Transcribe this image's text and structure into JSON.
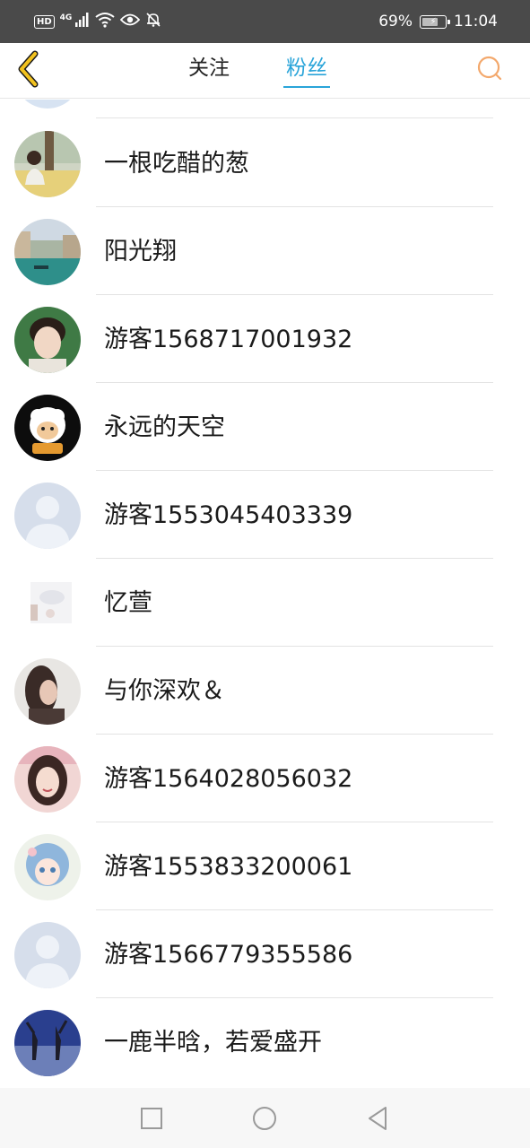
{
  "status_bar": {
    "left_badge": "HD",
    "network": "4G",
    "battery_text": "69%",
    "battery_level": 0.69,
    "time": "11:04",
    "icons": [
      "hd-icon",
      "signal-icon",
      "wifi-icon",
      "eye-icon",
      "bell-off-icon",
      "battery-icon"
    ]
  },
  "header": {
    "back_icon": "chevron-left-icon",
    "tabs": [
      {
        "label": "关注",
        "active": false
      },
      {
        "label": "粉丝",
        "active": true
      }
    ],
    "search_icon": "search-icon",
    "colors": {
      "active_tab": "#29a4d9",
      "back_icon": "#f2c21f",
      "search_icon": "#f3a86c"
    }
  },
  "fans": [
    {
      "name": "一根吃醋的葱",
      "avatar": "photo-girl-field"
    },
    {
      "name": "阳光翔",
      "avatar": "photo-canal"
    },
    {
      "name": "游客1568717001932",
      "avatar": "photo-boy"
    },
    {
      "name": "永远的天空",
      "avatar": "cartoon-goat"
    },
    {
      "name": "游客1553045403339",
      "avatar": "default-avatar"
    },
    {
      "name": "忆萱",
      "avatar": "photo-small-white"
    },
    {
      "name": "与你深欢＆",
      "avatar": "photo-girl-profile"
    },
    {
      "name": "游客1564028056032",
      "avatar": "photo-girl-selfie"
    },
    {
      "name": "游客1553833200061",
      "avatar": "anime-girl"
    },
    {
      "name": "游客1566779355586",
      "avatar": "default-avatar"
    },
    {
      "name": "一鹿半晗，若爱盛开",
      "avatar": "photo-silhouettes"
    }
  ],
  "nav_bar": {
    "icons": [
      "recents-square-icon",
      "home-circle-icon",
      "back-triangle-icon"
    ]
  }
}
